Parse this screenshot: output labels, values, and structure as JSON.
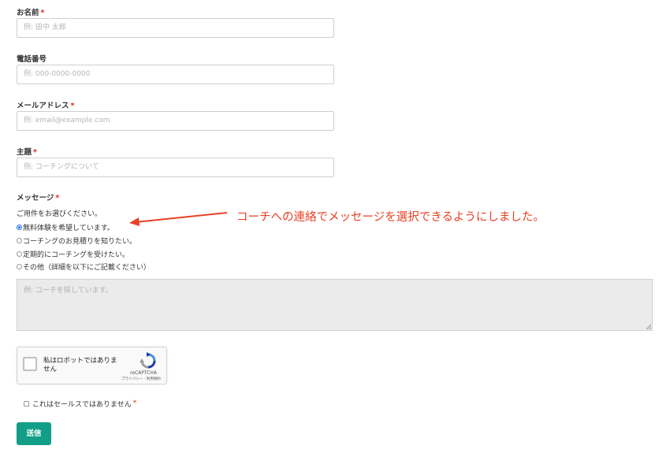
{
  "form": {
    "name": {
      "label": "お名前",
      "required_mark": "*",
      "placeholder": "例: 田中 太郎"
    },
    "phone": {
      "label": "電話番号",
      "placeholder": "例: 000-0000-0000"
    },
    "email": {
      "label": "メールアドレス",
      "required_mark": "*",
      "placeholder": "例: email@example.com"
    },
    "subject": {
      "label": "主題",
      "required_mark": "*",
      "placeholder": "例: コーチングについて"
    },
    "message": {
      "label": "メッセージ",
      "required_mark": "*",
      "prompt": "ご用件をお選びください。",
      "options": [
        {
          "label": "無料体験を希望しています。",
          "checked": true
        },
        {
          "label": "コーチングのお見積りを知りたい。",
          "checked": false
        },
        {
          "label": "定期的にコーチングを受けたい。",
          "checked": false
        },
        {
          "label": "その他（詳細を以下にご記載ください）",
          "checked": false
        }
      ],
      "textarea_placeholder": "例: コーチを探しています。"
    },
    "recaptcha": {
      "label": "私はロボットではありません",
      "brand": "reCAPTCHA",
      "links": "プライバシー - 利用規約"
    },
    "not_sales": {
      "label": "これはセールスではありません",
      "required_mark": "*"
    },
    "submit_label": "送信"
  },
  "annotation": {
    "text": "コーチへの連絡でメッセージを選択できるようにしました。",
    "color": "#e84125"
  },
  "colors": {
    "accent": "#129e87",
    "required": "#e02b20",
    "radio_checked": "#1a73e8"
  }
}
